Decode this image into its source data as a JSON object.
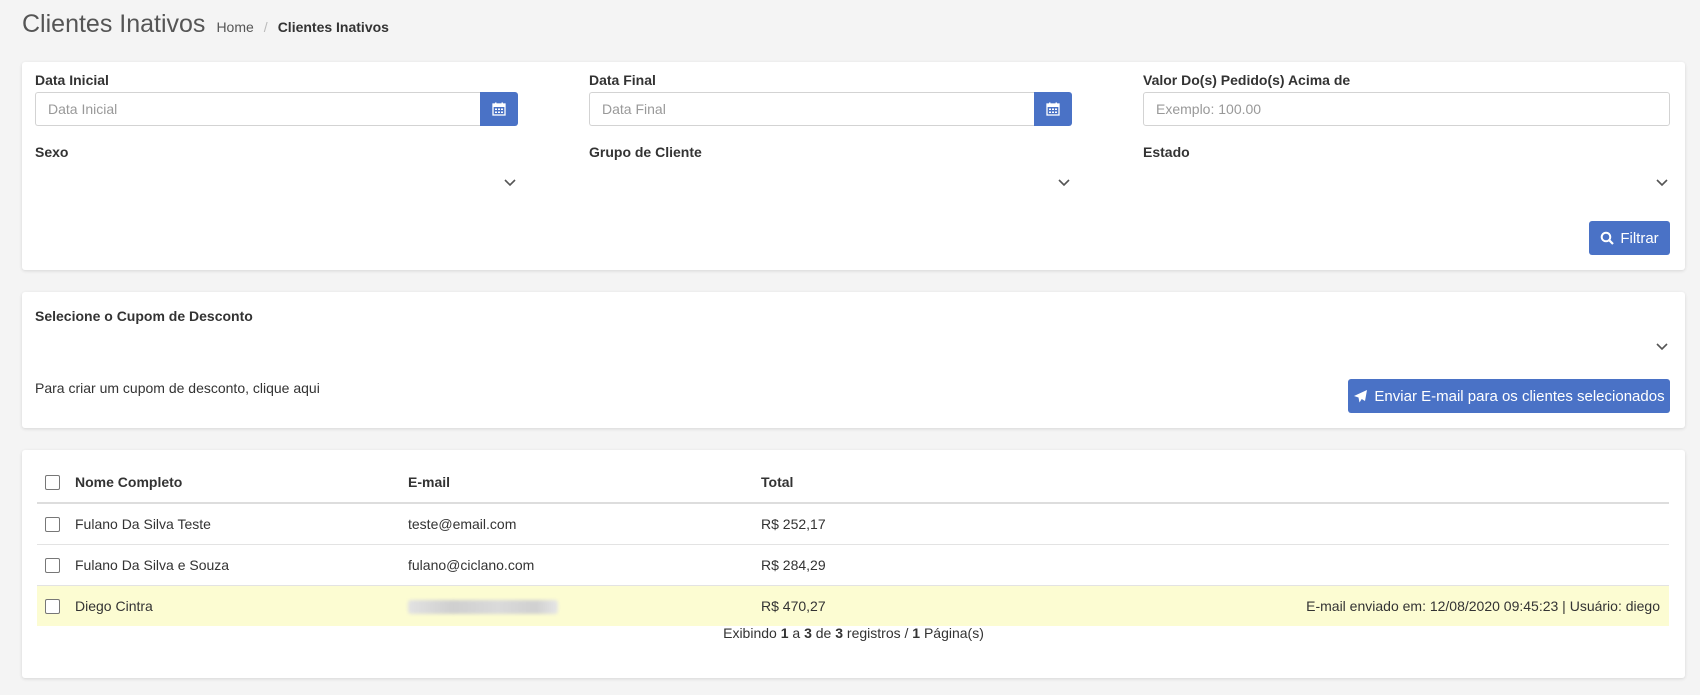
{
  "page": {
    "title": "Clientes Inativos"
  },
  "breadcrumb": {
    "home": "Home",
    "separator": "/",
    "current": "Clientes Inativos"
  },
  "filters": {
    "start_date_label": "Data Inicial",
    "start_date_placeholder": "Data Inicial",
    "end_date_label": "Data Final",
    "end_date_placeholder": "Data Final",
    "min_value_label": "Valor Do(s) Pedido(s) Acima de",
    "min_value_placeholder": "Exemplo: 100.00",
    "sex_label": "Sexo",
    "group_label": "Grupo de Cliente",
    "state_label": "Estado",
    "filter_button": "Filtrar",
    "icons": {
      "calendar": "calendar-icon",
      "search": "search-icon",
      "chevron": "chevron-down-icon"
    }
  },
  "coupon": {
    "label": "Selecione o Cupom de Desconto",
    "create_hint": "Para criar um cupom de desconto, clique aqui",
    "send_button": "Enviar E-mail para os clientes selecionados",
    "icons": {
      "send": "paper-plane-icon"
    }
  },
  "table": {
    "headers": {
      "name": "Nome Completo",
      "email": "E-mail",
      "total": "Total"
    },
    "rows": [
      {
        "name": "Fulano Da Silva Teste",
        "email": "teste@email.com",
        "total": "R$ 252,17",
        "status": ""
      },
      {
        "name": "Fulano Da Silva e Souza",
        "email": "fulano@ciclano.com",
        "total": "R$ 284,29",
        "status": ""
      },
      {
        "name": "Diego Cintra",
        "email": "",
        "total": "R$ 470,27",
        "status": "E-mail enviado em: 12/08/2020 09:45:23 | Usuário: diego"
      }
    ]
  },
  "pagination": {
    "prefix": "Exibindo",
    "from": "1",
    "a": "a",
    "to": "3",
    "de": "de",
    "total": "3",
    "registros": "registros /",
    "pages": "1",
    "pages_label": "Página(s)"
  },
  "colors": {
    "primary": "#4a72c6",
    "highlight_row": "#fcfcd2",
    "background": "#f4f4f4"
  }
}
